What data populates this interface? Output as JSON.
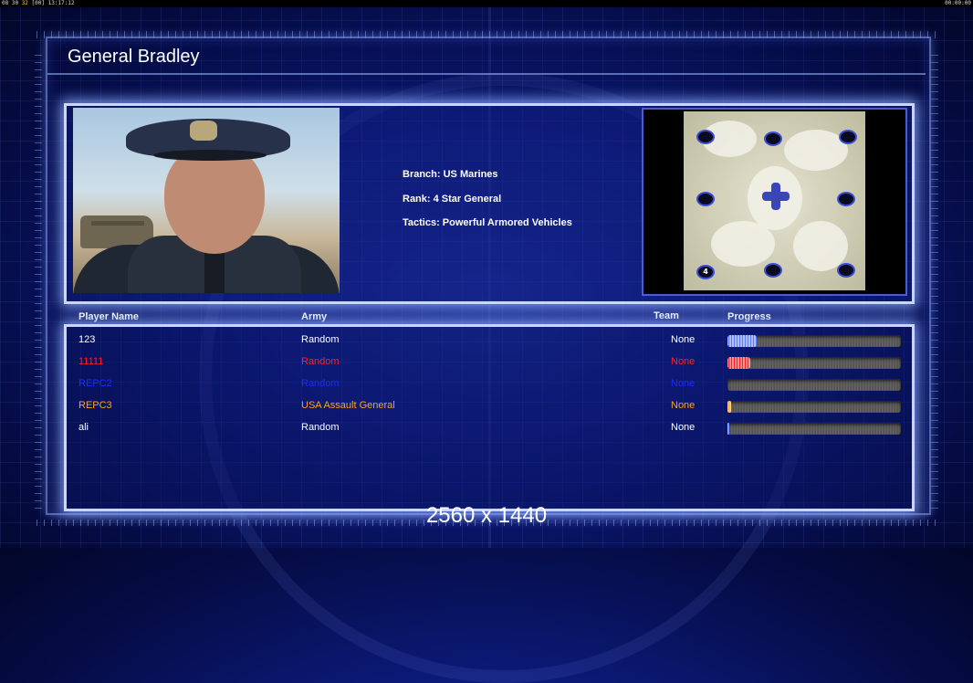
{
  "topbar": {
    "left_prefix": "08 30",
    "left_highlight": "32",
    "left_suffix": "[00] 13:17:12",
    "right": "00:00:00"
  },
  "general": {
    "title": "General Bradley",
    "branch": "Branch: US Marines",
    "rank": "Rank: 4 Star General",
    "tactics": "Tactics: Powerful Armored Vehicles"
  },
  "minimap": {
    "labeled_spot": "4"
  },
  "columns": {
    "player": "Player Name",
    "army": "Army",
    "team": "Team",
    "progress": "Progress"
  },
  "players": [
    {
      "name": "123",
      "army": "Random",
      "team": "None",
      "color": "#ffffff",
      "progress": 0.17,
      "fill_color": "#5c7cff"
    },
    {
      "name": "11111",
      "army": "Random",
      "team": "None",
      "color": "#ff2020",
      "progress": 0.13,
      "fill_color": "#ff2020"
    },
    {
      "name": "REPC2",
      "army": "Random",
      "team": "None",
      "color": "#1a2cff",
      "progress": 0.0,
      "fill_color": "#1a2cff"
    },
    {
      "name": "REPC3",
      "army": "USA Assault General",
      "team": "None",
      "color": "#ffa21e",
      "progress": 0.02,
      "fill_color": "#ffa21e"
    },
    {
      "name": "ali",
      "army": "Random",
      "team": "None",
      "color": "#ffffff",
      "progress": 0.01,
      "fill_color": "#5c7cff"
    }
  ],
  "resolution": "2560 x 1440"
}
